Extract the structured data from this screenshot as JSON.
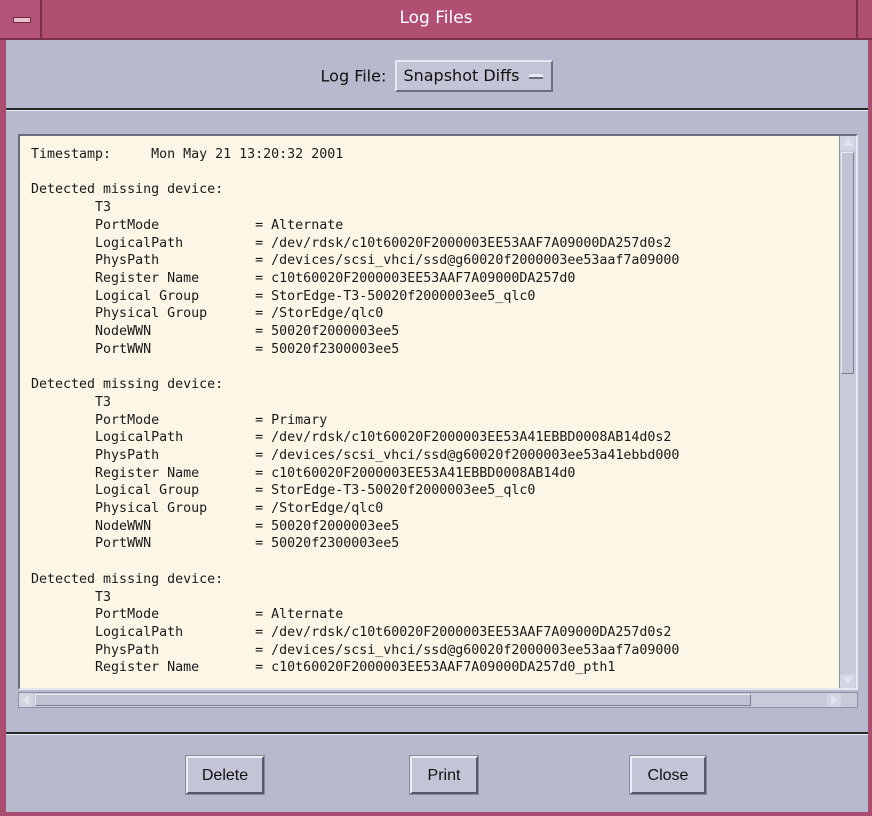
{
  "window": {
    "title": "Log Files"
  },
  "log_selector": {
    "label": "Log File:",
    "selected": "Snapshot Diffs"
  },
  "log_content": "Timestamp:     Mon May 21 13:20:32 2001\n\nDetected missing device:\n        T3\n        PortMode            = Alternate\n        LogicalPath         = /dev/rdsk/c10t60020F2000003EE53AAF7A09000DA257d0s2\n        PhysPath            = /devices/scsi_vhci/ssd@g60020f2000003ee53aaf7a09000\n        Register Name       = c10t60020F2000003EE53AAF7A09000DA257d0\n        Logical Group       = StorEdge-T3-50020f2000003ee5_qlc0\n        Physical Group      = /StorEdge/qlc0\n        NodeWWN             = 50020f2000003ee5\n        PortWWN             = 50020f2300003ee5\n\nDetected missing device:\n        T3\n        PortMode            = Primary\n        LogicalPath         = /dev/rdsk/c10t60020F2000003EE53A41EBBD0008AB14d0s2\n        PhysPath            = /devices/scsi_vhci/ssd@g60020f2000003ee53a41ebbd000\n        Register Name       = c10t60020F2000003EE53A41EBBD0008AB14d0\n        Logical Group       = StorEdge-T3-50020f2000003ee5_qlc0\n        Physical Group      = /StorEdge/qlc0\n        NodeWWN             = 50020f2000003ee5\n        PortWWN             = 50020f2300003ee5\n\nDetected missing device:\n        T3\n        PortMode            = Alternate\n        LogicalPath         = /dev/rdsk/c10t60020F2000003EE53AAF7A09000DA257d0s2\n        PhysPath            = /devices/scsi_vhci/ssd@g60020f2000003ee53aaf7a09000\n        Register Name       = c10t60020F2000003EE53AAF7A09000DA257d0_pth1",
  "buttons": {
    "delete": "Delete",
    "print": "Print",
    "close": "Close"
  }
}
